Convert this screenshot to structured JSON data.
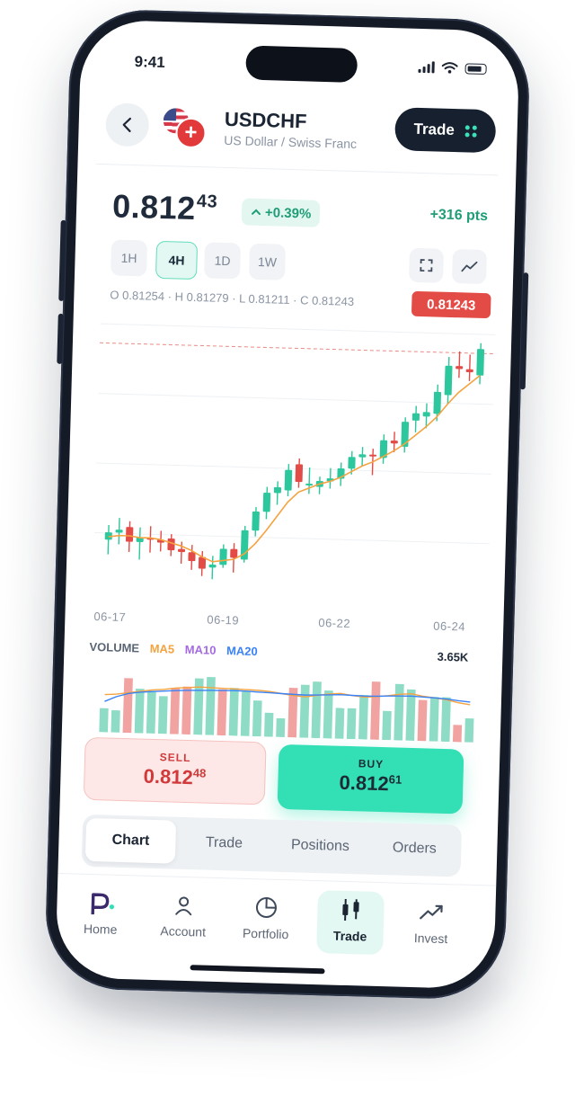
{
  "status_bar": {
    "time": "9:41"
  },
  "header": {
    "back_icon": "chevron-left-icon",
    "pair": "USDCHF",
    "subtitle": "US Dollar / Swiss Franc",
    "trade_button": "Trade",
    "flags": [
      "us-flag-icon",
      "swiss-flag-icon"
    ]
  },
  "quote": {
    "price_main": "0.812",
    "price_sup": "43",
    "change": "+0.39%",
    "points": "+316 pts",
    "colors": {
      "up": "#1f9d77",
      "down": "#e34b46",
      "accent": "#33dfb4"
    }
  },
  "timeframes": {
    "options": [
      "1H",
      "4H",
      "1D",
      "1W"
    ],
    "selected": "4H",
    "tools": [
      "fullscreen-icon",
      "line-chart-icon"
    ]
  },
  "ohlc": {
    "text": "O 0.81254 · H 0.81279 · L 0.81211 · C 0.81243",
    "last_price": "0.81243"
  },
  "chart_data": {
    "type": "candlestick",
    "x_tick_labels": [
      "06-17",
      "06-19",
      "06-22",
      "06-24"
    ],
    "candles": [
      {
        "o": 0.8053,
        "h": 0.8063,
        "l": 0.8043,
        "c": 0.8058
      },
      {
        "o": 0.8058,
        "h": 0.8068,
        "l": 0.805,
        "c": 0.806
      },
      {
        "o": 0.8062,
        "h": 0.8066,
        "l": 0.8045,
        "c": 0.8052
      },
      {
        "o": 0.8052,
        "h": 0.8062,
        "l": 0.804,
        "c": 0.8055
      },
      {
        "o": 0.8055,
        "h": 0.8063,
        "l": 0.8045,
        "c": 0.8054
      },
      {
        "o": 0.8054,
        "h": 0.806,
        "l": 0.8046,
        "c": 0.8052
      },
      {
        "o": 0.8055,
        "h": 0.8058,
        "l": 0.8043,
        "c": 0.8047
      },
      {
        "o": 0.8048,
        "h": 0.8053,
        "l": 0.8038,
        "c": 0.8046
      },
      {
        "o": 0.8046,
        "h": 0.8051,
        "l": 0.8034,
        "c": 0.804
      },
      {
        "o": 0.8043,
        "h": 0.8047,
        "l": 0.803,
        "c": 0.8035
      },
      {
        "o": 0.8036,
        "h": 0.8044,
        "l": 0.8028,
        "c": 0.8038
      },
      {
        "o": 0.8038,
        "h": 0.8052,
        "l": 0.8036,
        "c": 0.8049
      },
      {
        "o": 0.8049,
        "h": 0.8053,
        "l": 0.8033,
        "c": 0.8043
      },
      {
        "o": 0.8042,
        "h": 0.8065,
        "l": 0.804,
        "c": 0.8062
      },
      {
        "o": 0.8062,
        "h": 0.8078,
        "l": 0.8058,
        "c": 0.8075
      },
      {
        "o": 0.8075,
        "h": 0.8092,
        "l": 0.807,
        "c": 0.8088
      },
      {
        "o": 0.8088,
        "h": 0.8096,
        "l": 0.808,
        "c": 0.8092
      },
      {
        "o": 0.809,
        "h": 0.8108,
        "l": 0.8086,
        "c": 0.8104
      },
      {
        "o": 0.8108,
        "h": 0.8112,
        "l": 0.8092,
        "c": 0.8096
      },
      {
        "o": 0.8094,
        "h": 0.8106,
        "l": 0.8088,
        "c": 0.8095
      },
      {
        "o": 0.8093,
        "h": 0.81,
        "l": 0.8088,
        "c": 0.8097
      },
      {
        "o": 0.8097,
        "h": 0.8106,
        "l": 0.8092,
        "c": 0.8099
      },
      {
        "o": 0.8099,
        "h": 0.811,
        "l": 0.8094,
        "c": 0.8106
      },
      {
        "o": 0.8106,
        "h": 0.8118,
        "l": 0.8102,
        "c": 0.8114
      },
      {
        "o": 0.8114,
        "h": 0.8121,
        "l": 0.8108,
        "c": 0.8116
      },
      {
        "o": 0.8116,
        "h": 0.812,
        "l": 0.8102,
        "c": 0.8115
      },
      {
        "o": 0.8114,
        "h": 0.813,
        "l": 0.811,
        "c": 0.8126
      },
      {
        "o": 0.8126,
        "h": 0.8132,
        "l": 0.8118,
        "c": 0.8124
      },
      {
        "o": 0.8122,
        "h": 0.8142,
        "l": 0.8118,
        "c": 0.8139
      },
      {
        "o": 0.814,
        "h": 0.815,
        "l": 0.8132,
        "c": 0.8145
      },
      {
        "o": 0.8143,
        "h": 0.8152,
        "l": 0.8135,
        "c": 0.8146
      },
      {
        "o": 0.8145,
        "h": 0.8165,
        "l": 0.814,
        "c": 0.816
      },
      {
        "o": 0.8158,
        "h": 0.8184,
        "l": 0.8152,
        "c": 0.8178
      },
      {
        "o": 0.8178,
        "h": 0.8188,
        "l": 0.817,
        "c": 0.8176
      },
      {
        "o": 0.8176,
        "h": 0.8186,
        "l": 0.8168,
        "c": 0.8174
      },
      {
        "o": 0.8172,
        "h": 0.8194,
        "l": 0.8166,
        "c": 0.819
      }
    ],
    "ma_line": [
      0.8055,
      0.8056,
      0.8056,
      0.8055,
      0.8055,
      0.8054,
      0.8052,
      0.805,
      0.8047,
      0.8043,
      0.804,
      0.8041,
      0.8042,
      0.8046,
      0.8053,
      0.8062,
      0.8072,
      0.8082,
      0.8089,
      0.8092,
      0.8095,
      0.8097,
      0.81,
      0.8104,
      0.8108,
      0.8111,
      0.8115,
      0.8119,
      0.8124,
      0.813,
      0.8136,
      0.8143,
      0.8152,
      0.816,
      0.8166,
      0.8172
    ],
    "ylim": [
      0.801,
      0.82
    ],
    "last_price_value": 0.8187,
    "volume": {
      "label": "VOLUME",
      "indicators": [
        "MA5",
        "MA10",
        "MA20"
      ],
      "indicator_colors": [
        "#f4a340",
        "#a46be0",
        "#3b82f6"
      ],
      "last_value": "3.65K",
      "bars": [
        {
          "v": 1.4,
          "up": true
        },
        {
          "v": 1.3,
          "up": true
        },
        {
          "v": 3.2,
          "up": false
        },
        {
          "v": 2.6,
          "up": true
        },
        {
          "v": 2.5,
          "up": true
        },
        {
          "v": 2.2,
          "up": true
        },
        {
          "v": 2.7,
          "up": false
        },
        {
          "v": 2.8,
          "up": false
        },
        {
          "v": 3.3,
          "up": true
        },
        {
          "v": 3.4,
          "up": true
        },
        {
          "v": 2.7,
          "up": false
        },
        {
          "v": 2.8,
          "up": true
        },
        {
          "v": 2.6,
          "up": true
        },
        {
          "v": 2.1,
          "up": true
        },
        {
          "v": 1.4,
          "up": true
        },
        {
          "v": 1.1,
          "up": true
        },
        {
          "v": 2.9,
          "up": false
        },
        {
          "v": 3.1,
          "up": true
        },
        {
          "v": 3.3,
          "up": true
        },
        {
          "v": 2.8,
          "up": true
        },
        {
          "v": 1.8,
          "up": true
        },
        {
          "v": 1.8,
          "up": true
        },
        {
          "v": 2.6,
          "up": true
        },
        {
          "v": 3.4,
          "up": false
        },
        {
          "v": 1.7,
          "up": true
        },
        {
          "v": 3.3,
          "up": true
        },
        {
          "v": 3.0,
          "up": true
        },
        {
          "v": 2.4,
          "up": false
        },
        {
          "v": 2.6,
          "up": true
        },
        {
          "v": 2.6,
          "up": true
        },
        {
          "v": 1.0,
          "up": false
        },
        {
          "v": 1.4,
          "up": true
        }
      ],
      "ma5": [
        2.2,
        2.25,
        2.35,
        2.45,
        2.55,
        2.6,
        2.7,
        2.75,
        2.8,
        2.78,
        2.76,
        2.74,
        2.72,
        2.7,
        2.65,
        2.55,
        2.45,
        2.4,
        2.5,
        2.6,
        2.65,
        2.55,
        2.48,
        2.52,
        2.6,
        2.7,
        2.75,
        2.62,
        2.55,
        2.45,
        2.3,
        2.2
      ],
      "ma10": [
        1.8,
        2.1,
        2.3,
        2.4,
        2.45,
        2.5,
        2.55,
        2.58,
        2.6,
        2.62,
        2.63,
        2.64,
        2.63,
        2.6,
        2.58,
        2.55,
        2.52,
        2.5,
        2.52,
        2.55,
        2.58,
        2.56,
        2.54,
        2.55,
        2.58,
        2.6,
        2.61,
        2.58,
        2.55,
        2.5,
        2.42,
        2.36
      ],
      "ymax": 4.0
    }
  },
  "actions": {
    "sell_label": "SELL",
    "sell_main": "0.812",
    "sell_sup": "48",
    "buy_label": "BUY",
    "buy_main": "0.812",
    "buy_sup": "61"
  },
  "tabs": {
    "items": [
      "Chart",
      "Trade",
      "Positions",
      "Orders"
    ],
    "selected": "Chart"
  },
  "bottom_nav": {
    "items": [
      {
        "label": "Home",
        "icon": "brand-logo-icon"
      },
      {
        "label": "Account",
        "icon": "user-icon"
      },
      {
        "label": "Portfolio",
        "icon": "pie-chart-icon"
      },
      {
        "label": "Trade",
        "icon": "candlestick-icon"
      },
      {
        "label": "Invest",
        "icon": "trend-up-icon"
      }
    ],
    "selected": "Trade"
  }
}
